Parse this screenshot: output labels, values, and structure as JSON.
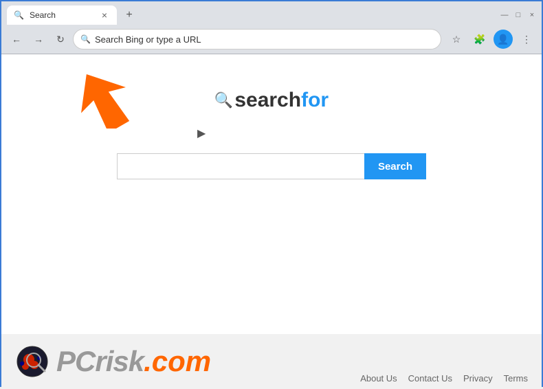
{
  "browser": {
    "tab": {
      "title": "Search",
      "close_icon": "×"
    },
    "new_tab_icon": "+",
    "window_controls": {
      "minimize": "—",
      "maximize": "□",
      "close": "×"
    },
    "address_bar": {
      "placeholder": "Search Bing or type a URL",
      "value": "Search Bing or type a URL"
    },
    "nav": {
      "back": "←",
      "forward": "→",
      "refresh": "↻",
      "search_icon": "🔍"
    }
  },
  "page": {
    "logo": {
      "icon": "🔍",
      "text_search": "search",
      "text_for": "for"
    },
    "search": {
      "input_placeholder": "",
      "button_label": "Search"
    }
  },
  "footer": {
    "links": [
      {
        "label": "About Us"
      },
      {
        "label": "Contact Us"
      },
      {
        "label": "Privacy"
      },
      {
        "label": "Terms"
      }
    ],
    "pcrisk_pc": "PC",
    "pcrisk_risk": "risk",
    "pcrisk_dotcom": ".com"
  },
  "accent_color": "#2196F3",
  "arrow_color": "#ff6600"
}
